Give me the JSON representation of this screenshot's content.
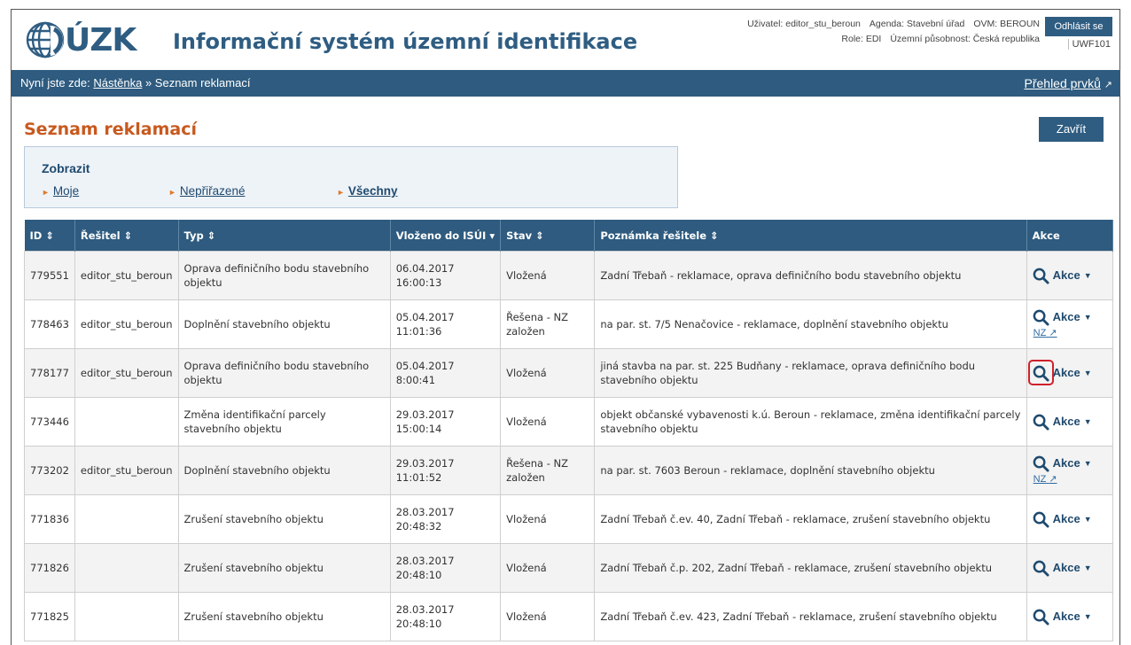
{
  "header": {
    "logo_text": "ÚZK",
    "app_title": "Informační systém územní identifikace",
    "user_line1": [
      "Uživatel: editor_stu_beroun",
      "Agenda: Stavební úřad",
      "OVM: BEROUN"
    ],
    "user_line2": [
      "Role: EDI",
      "Územní působnost: Česká republika"
    ],
    "logout_label": "Odhlásit se",
    "uwf": "UWF101"
  },
  "nav": {
    "prefix": "Nyní jste zde:",
    "crumb_home": "Nástěnka",
    "separator": "»",
    "crumb_current": "Seznam reklamací",
    "right_link": "Přehled prvků"
  },
  "page": {
    "title": "Seznam reklamací",
    "close_label": "Zavřít"
  },
  "filter": {
    "title": "Zobrazit",
    "options": [
      "Moje",
      "Nepřiřazené",
      "Všechny"
    ]
  },
  "table": {
    "columns": [
      "ID",
      "Řešitel",
      "Typ",
      "Vloženo do ISÚI",
      "Stav",
      "Poznámka řešitele",
      "Akce"
    ],
    "action_label": "Akce",
    "nz_label": "NZ",
    "rows": [
      {
        "id": "779551",
        "resitel": "editor_stu_beroun",
        "typ": "Oprava definičního bodu stavebního objektu",
        "vlozeno": "06.04.2017 16:00:13",
        "stav": "Vložená",
        "poznamka": "Zadní Třebaň - reklamace, oprava definičního bodu stavebního objektu",
        "nz": false
      },
      {
        "id": "778463",
        "resitel": "editor_stu_beroun",
        "typ": "Doplnění stavebního objektu",
        "vlozeno": "05.04.2017 11:01:36",
        "stav": "Řešena - NZ založen",
        "poznamka": "na par. st. 7/5 Nenačovice - reklamace, doplnění stavebního objektu",
        "nz": true
      },
      {
        "id": "778177",
        "resitel": "editor_stu_beroun",
        "typ": "Oprava definičního bodu stavebního objektu",
        "vlozeno": "05.04.2017 8:00:41",
        "stav": "Vložená",
        "poznamka": "jiná stavba na par. st. 225 Budňany - reklamace, oprava definičního bodu stavebního objektu",
        "nz": false
      },
      {
        "id": "773446",
        "resitel": "",
        "typ": "Změna identifikační parcely stavebního objektu",
        "vlozeno": "29.03.2017 15:00:14",
        "stav": "Vložená",
        "poznamka": "objekt občanské vybavenosti k.ú. Beroun - reklamace, změna identifikační parcely stavebního objektu",
        "nz": false
      },
      {
        "id": "773202",
        "resitel": "editor_stu_beroun",
        "typ": "Doplnění stavebního objektu",
        "vlozeno": "29.03.2017 11:01:52",
        "stav": "Řešena - NZ založen",
        "poznamka": "na par. st. 7603 Beroun - reklamace, doplnění stavebního objektu",
        "nz": true
      },
      {
        "id": "771836",
        "resitel": "",
        "typ": "Zrušení stavebního objektu",
        "vlozeno": "28.03.2017 20:48:32",
        "stav": "Vložená",
        "poznamka": "Zadní Třebaň č.ev. 40, Zadní Třebaň - reklamace, zrušení stavebního objektu",
        "nz": false
      },
      {
        "id": "771826",
        "resitel": "",
        "typ": "Zrušení stavebního objektu",
        "vlozeno": "28.03.2017 20:48:10",
        "stav": "Vložená",
        "poznamka": "Zadní Třebaň č.p. 202, Zadní Třebaň - reklamace, zrušení stavebního objektu",
        "nz": false
      },
      {
        "id": "771825",
        "resitel": "",
        "typ": "Zrušení stavebního objektu",
        "vlozeno": "28.03.2017 20:48:10",
        "stav": "Vložená",
        "poznamka": "Zadní Třebaň č.ev. 423, Zadní Třebaň - reklamace, zrušení stavebního objektu",
        "nz": false
      }
    ]
  },
  "colors": {
    "brand": "#2f5d82",
    "accent": "#c8591e",
    "highlight": "#d0202a"
  }
}
